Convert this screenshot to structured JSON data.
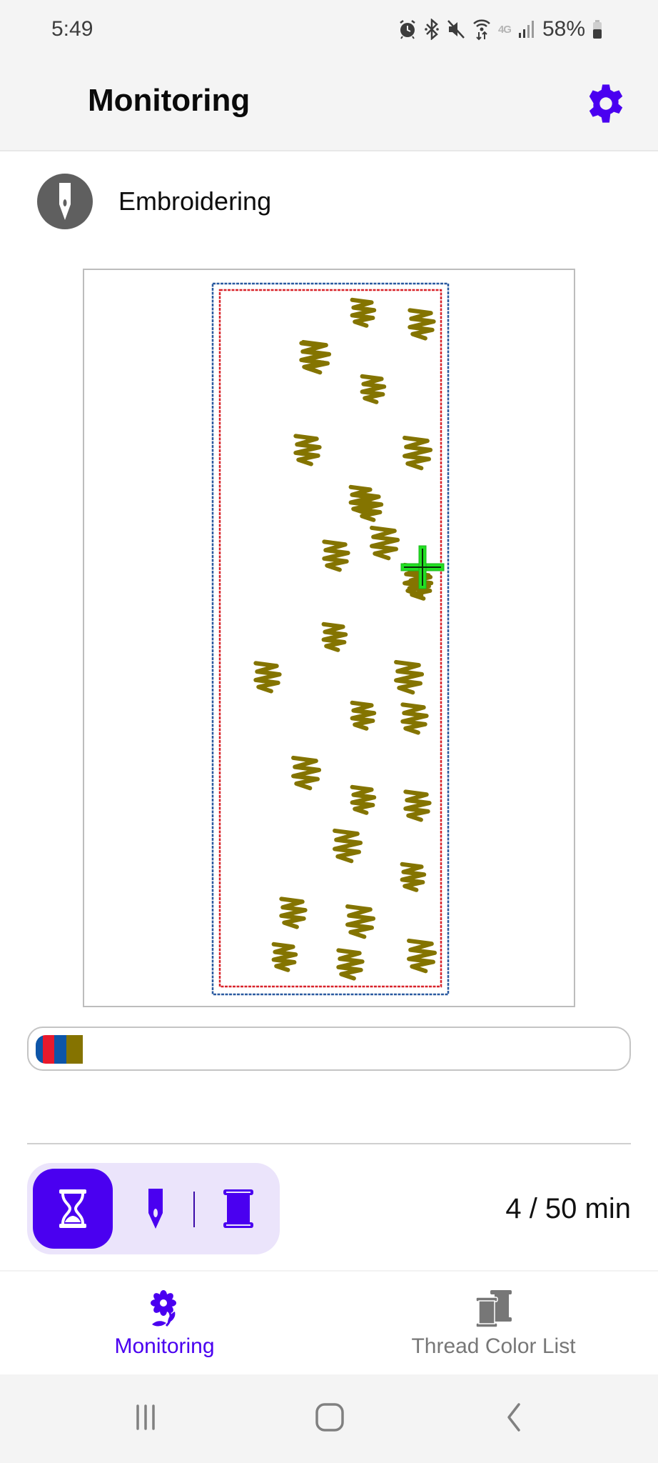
{
  "status_bar": {
    "time": "5:49",
    "icons": [
      "alarm-icon",
      "bluetooth-icon",
      "mute-icon",
      "wifi-icon",
      "lte-icon",
      "signal-icon"
    ],
    "network_label": "4G",
    "battery_percent": "58%"
  },
  "app_bar": {
    "title": "Monitoring",
    "settings_icon": "gear-icon"
  },
  "machine_state": {
    "icon": "needle-icon",
    "label": "Embroidering"
  },
  "preview": {
    "outer_border_color": "#2a5aa0",
    "inner_border_color": "#d8232a",
    "stitch_color": "#847400",
    "cursor_color": "#22e022",
    "stitch_count": 28
  },
  "progress": {
    "fraction": 0.08,
    "segments": [
      {
        "color": "#0d55a8",
        "share": 0.15
      },
      {
        "color": "#e8192c",
        "share": 0.25
      },
      {
        "color": "#0d55a8",
        "share": 0.25
      },
      {
        "color": "#857300",
        "share": 0.35
      }
    ]
  },
  "modes": {
    "items": [
      {
        "name": "time",
        "icon": "hourglass-icon",
        "active": true
      },
      {
        "name": "stitch",
        "icon": "needle-icon",
        "active": false
      },
      {
        "name": "thread",
        "icon": "spool-icon",
        "active": false
      }
    ]
  },
  "time_readout": "4 / 50 min",
  "bottom_nav": {
    "items": [
      {
        "label": "Monitoring",
        "icon": "flower-icon",
        "active": true
      },
      {
        "label": "Thread Color List",
        "icon": "thread-spools-icon",
        "active": false
      }
    ]
  },
  "system_nav": {
    "recents": "recents-icon",
    "home": "home-icon",
    "back": "back-icon"
  },
  "colors": {
    "accent": "#4a00f0",
    "accent_light": "#ebe4fb",
    "bar_bg": "#f4f4f4"
  }
}
